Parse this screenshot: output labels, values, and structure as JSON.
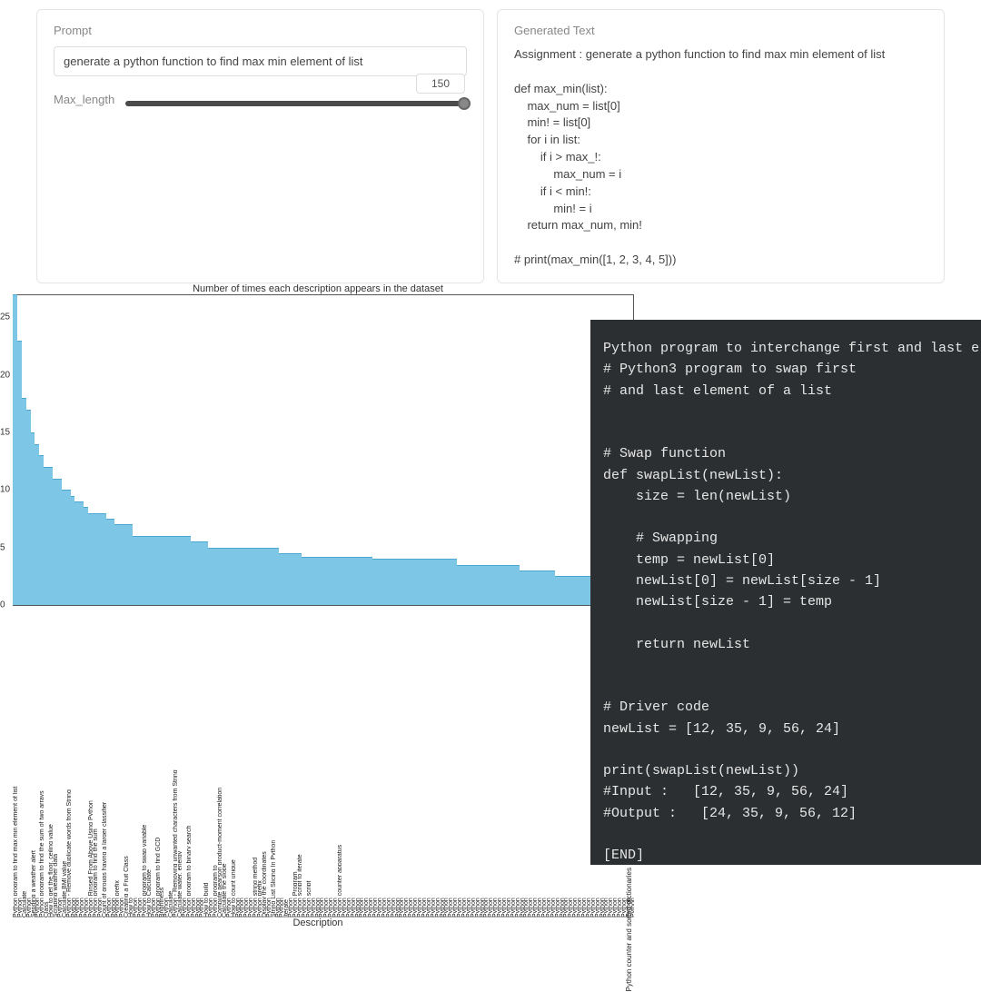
{
  "prompt": {
    "label": "Prompt",
    "value": "generate a python function to find max min element of list"
  },
  "max_length": {
    "label": "Max_length",
    "value": "150"
  },
  "generated": {
    "label": "Generated Text",
    "text": "Assignment : generate a python function to find max min element of list\n\ndef max_min(list):\n    max_num = list[0]\n    min! = list[0]\n    for i in list:\n        if i > max_!:\n            max_num = i\n        if i < min!:\n            min! = i\n    return max_num, min!\n\n# print(max_min([1, 2, 3, 4, 5]))"
  },
  "chart_data": {
    "type": "bar",
    "title": "Number of times each description appears in the dataset",
    "xlabel": "Description",
    "ylabel": "",
    "ylim": [
      0,
      27
    ],
    "yticks": [
      0,
      5,
      10,
      15,
      20,
      25
    ],
    "categories": [
      "Python program to find max min element of list",
      "Python",
      "Calculate",
      "Python",
      "Sending a weather alert",
      "Python",
      "Python program to find the sum of two arrays",
      "Class",
      "How to get the floor, ceiling value",
      "Scraping weather data",
      "Python",
      "Calculate BMI value",
      "Python - Remove duplicate words from String",
      "Python",
      "Python",
      "Python",
      "Python",
      "Python Rinsed From Above Using Python",
      "Python program to find the sum",
      "Python",
      "Count of groups having a larger classifier",
      "Python",
      "Python",
      "Python prefix",
      "Python",
      "Creating a Fruit Class",
      "How to",
      "Python",
      "Python",
      "Python program to swap variable",
      "How to Calculate",
      "Python",
      "Python program to find GCD",
      "Brightness",
      "Python",
      "Calculate",
      "Python - Removing unwanted characters from String",
      "Calculate water, energy",
      "Python",
      "Python program to binary search",
      "Python",
      "Python",
      "Python",
      "How to build",
      "Python",
      "Python program to",
      "Compute pearson product-moment correlation",
      "Calculate the slope",
      "Python",
      "How to count unique",
      "Python",
      "Python",
      "Python",
      "Python",
      "Python string method",
      "Python prefix",
      "Display the coordinates",
      "Python",
      "String List Slicing In Python",
      "Python",
      "Python",
      "Iterate",
      "Python",
      "Python Program",
      "Python script to iterate",
      "Python",
      "Python script",
      "Python",
      "Python",
      "Python",
      "Python",
      "Python",
      "Python",
      "Python counter apparatus",
      "Python",
      "Python",
      "Python",
      "Python",
      "Python",
      "Python",
      "Python",
      "Python",
      "Python",
      "Python",
      "Python",
      "Python",
      "Python",
      "Python",
      "Python",
      "Python",
      "Python",
      "Python",
      "Python",
      "Python",
      "Python",
      "Python",
      "Python",
      "Python",
      "Python",
      "Python",
      "Python",
      "Python",
      "Python",
      "Python",
      "Python",
      "Python",
      "Python",
      "Python",
      "Python",
      "Python",
      "Python",
      "Python",
      "Python",
      "Python",
      "Python",
      "Python",
      "Python",
      "Python",
      "Python",
      "Python",
      "Python",
      "Python",
      "Python",
      "Python",
      "Python",
      "Python",
      "Python",
      "Python",
      "Python",
      "Python",
      "Python",
      "Python",
      "Python",
      "Python",
      "Python",
      "Python",
      "Python",
      "Python",
      "Python",
      "Python"
    ],
    "values": [
      27,
      23,
      18,
      17,
      15,
      14,
      13,
      12,
      12,
      11,
      11,
      10,
      10,
      9.5,
      9,
      9,
      8.5,
      8,
      8,
      8,
      8,
      7.5,
      7.5,
      7,
      7,
      7,
      7,
      6,
      6,
      6,
      6,
      6,
      6,
      6,
      6,
      6,
      6,
      6,
      6,
      6,
      5.5,
      5.5,
      5.5,
      5.5,
      5,
      5,
      5,
      5,
      5,
      5,
      5,
      5,
      5,
      5,
      5,
      5,
      5,
      5,
      5,
      5,
      4.5,
      4.5,
      4.5,
      4.5,
      4.5,
      4.2,
      4.2,
      4.2,
      4.2,
      4.2,
      4.2,
      4.2,
      4.2,
      4.2,
      4.2,
      4.2,
      4.2,
      4.2,
      4.2,
      4.2,
      4.2,
      4,
      4,
      4,
      4,
      4,
      4,
      4,
      4,
      4,
      4,
      4,
      4,
      4,
      4,
      4,
      4,
      4,
      4,
      4,
      3.5,
      3.5,
      3.5,
      3.5,
      3.5,
      3.5,
      3.5,
      3.5,
      3.5,
      3.5,
      3.5,
      3.5,
      3.5,
      3.5,
      3,
      3,
      3,
      3,
      3,
      3,
      3,
      3,
      2.5,
      2.5,
      2.5,
      2.5,
      2.5,
      2.5,
      2.5,
      2.5,
      2.5,
      2.5,
      2,
      2,
      2,
      2,
      2,
      2,
      2,
      2
    ]
  },
  "side_vertical_label": "Python counter and sorted dictionaries",
  "dark_code": "Python program to interchange first and last e\n# Python3 program to swap first\n# and last element of a list\n\n\n# Swap function\ndef swapList(newList):\n    size = len(newList)\n\n    # Swapping\n    temp = newList[0]\n    newList[0] = newList[size - 1]\n    newList[size - 1] = temp\n\n    return newList\n\n\n# Driver code\nnewList = [12, 35, 9, 56, 24]\n\nprint(swapList(newList))\n#Input :   [12, 35, 9, 56, 24]\n#Output :   [24, 35, 9, 56, 12]\n\n[END]"
}
